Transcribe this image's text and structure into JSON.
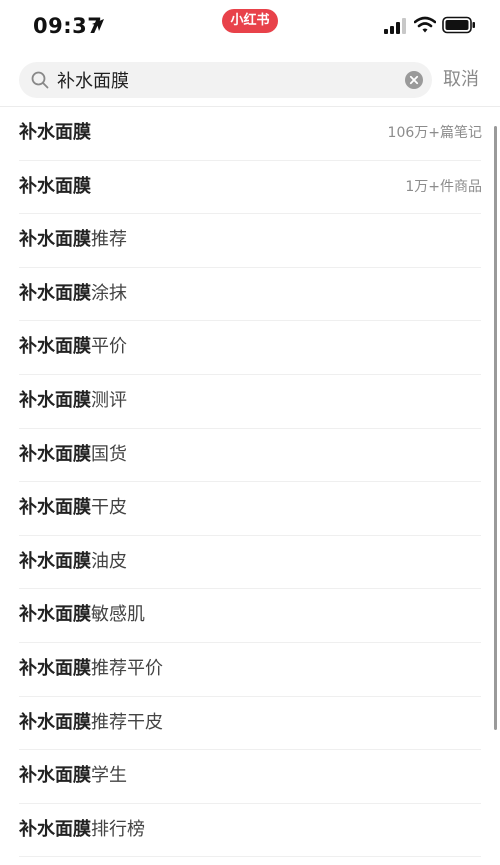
{
  "status_bar": {
    "time": "09:37",
    "app_badge": "小红书",
    "accent": "#e8424a"
  },
  "search": {
    "query": "补水面膜",
    "cancel_label": "取消"
  },
  "suggestions": [
    {
      "keyword": "补水面膜",
      "rest": "",
      "meta": "106万+篇笔记"
    },
    {
      "keyword": "补水面膜",
      "rest": "",
      "meta": "1万+件商品"
    },
    {
      "keyword": "补水面膜",
      "rest": "推荐"
    },
    {
      "keyword": "补水面膜",
      "rest": "涂抹"
    },
    {
      "keyword": "补水面膜",
      "rest": "平价"
    },
    {
      "keyword": "补水面膜",
      "rest": "测评"
    },
    {
      "keyword": "补水面膜",
      "rest": "国货"
    },
    {
      "keyword": "补水面膜",
      "rest": "干皮"
    },
    {
      "keyword": "补水面膜",
      "rest": "油皮"
    },
    {
      "keyword": "补水面膜",
      "rest": "敏感肌"
    },
    {
      "keyword": "补水面膜",
      "rest": "推荐平价"
    },
    {
      "keyword": "补水面膜",
      "rest": "推荐干皮"
    },
    {
      "keyword": "补水面膜",
      "rest": "学生"
    },
    {
      "keyword": "补水面膜",
      "rest": "排行榜"
    }
  ]
}
